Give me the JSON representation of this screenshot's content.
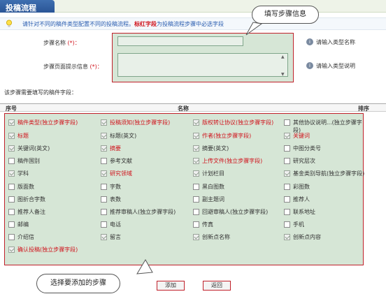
{
  "page": {
    "title": "投稿流程"
  },
  "tip": {
    "text_before": "请针对不同的稿件类型配置不同的投稿流程。",
    "text_red": "标红字段",
    "text_after": "为投稿流程步骤中必选字段"
  },
  "form": {
    "step_name_label": "步骤名称",
    "step_name_req": "(*)：",
    "step_hint_label": "步骤页面提示信息",
    "step_hint_req": "(*)：",
    "step_name_hint": "请输入类型名称",
    "step_hint_hint": "请输入类型说明"
  },
  "callouts": {
    "top": "填写步骤信息",
    "bottom": "选择要添加的步骤"
  },
  "fields_section": {
    "label": "该步骤需要填写的稿件字段：",
    "headers": {
      "index": "序号",
      "name": "名称",
      "order": "排序"
    }
  },
  "fields": [
    [
      {
        "label": "稿件类型(独立步骤字段)",
        "red": true,
        "checked": true
      },
      {
        "label": "投稿须知(独立步骤字段)",
        "red": true,
        "checked": true
      },
      {
        "label": "版权转让协议(独立步骤字段)",
        "red": true,
        "checked": true
      },
      {
        "label": "其他协议说明...(独立步骤字段)",
        "red": false,
        "checked": false
      }
    ],
    [
      {
        "label": "标题",
        "red": true,
        "checked": true
      },
      {
        "label": "标题(英文)",
        "red": false,
        "checked": true
      },
      {
        "label": "作者(独立步骤字段)",
        "red": true,
        "checked": true
      },
      {
        "label": "关键词",
        "red": true,
        "checked": true
      }
    ],
    [
      {
        "label": "关键词(英文)",
        "red": false,
        "checked": true
      },
      {
        "label": "摘要",
        "red": true,
        "checked": true
      },
      {
        "label": "摘要(英文)",
        "red": false,
        "checked": true
      },
      {
        "label": "中图分类号",
        "red": false,
        "checked": false
      }
    ],
    [
      {
        "label": "稿件国别",
        "red": false,
        "checked": false
      },
      {
        "label": "参考文献",
        "red": false,
        "checked": false
      },
      {
        "label": "上传文件(独立步骤字段)",
        "red": true,
        "checked": true
      },
      {
        "label": "研究层次",
        "red": false,
        "checked": false
      }
    ],
    [
      {
        "label": "学科",
        "red": false,
        "checked": true
      },
      {
        "label": "研究领域",
        "red": true,
        "checked": true
      },
      {
        "label": "计划栏目",
        "red": false,
        "checked": true
      },
      {
        "label": "基金类别导航(独立步骤字段)",
        "red": false,
        "checked": true
      }
    ],
    [
      {
        "label": "版面数",
        "red": false,
        "checked": false
      },
      {
        "label": "字数",
        "red": false,
        "checked": false
      },
      {
        "label": "黑白图数",
        "red": false,
        "checked": false
      },
      {
        "label": "彩图数",
        "red": false,
        "checked": false
      }
    ],
    [
      {
        "label": "图折合字数",
        "red": false,
        "checked": false
      },
      {
        "label": "表数",
        "red": false,
        "checked": false
      },
      {
        "label": "副主题词",
        "red": false,
        "checked": false
      },
      {
        "label": "推荐人",
        "red": false,
        "checked": false
      }
    ],
    [
      {
        "label": "推荐人备注",
        "red": false,
        "checked": false
      },
      {
        "label": "推荐审稿人(独立步骤字段)",
        "red": false,
        "checked": false
      },
      {
        "label": "回避审稿人(独立步骤字段)",
        "red": false,
        "checked": false
      },
      {
        "label": "联系地址",
        "red": false,
        "checked": false
      }
    ],
    [
      {
        "label": "邮编",
        "red": false,
        "checked": false
      },
      {
        "label": "电话",
        "red": false,
        "checked": false
      },
      {
        "label": "传真",
        "red": false,
        "checked": false
      },
      {
        "label": "手机",
        "red": false,
        "checked": false
      }
    ],
    [
      {
        "label": "介绍信",
        "red": false,
        "checked": false
      },
      {
        "label": "留言",
        "red": false,
        "checked": true
      },
      {
        "label": "创新点名称",
        "red": false,
        "checked": true
      },
      {
        "label": "创新点内容",
        "red": false,
        "checked": true
      }
    ],
    [
      {
        "label": "确认投稿(独立步骤字段)",
        "red": true,
        "checked": true
      }
    ]
  ],
  "buttons": {
    "add": "添加",
    "back": "返回"
  },
  "colors": {
    "highlight_fill": "#d6e6d6",
    "highlight_border": "#c0202a",
    "required_text": "#d0121b"
  }
}
